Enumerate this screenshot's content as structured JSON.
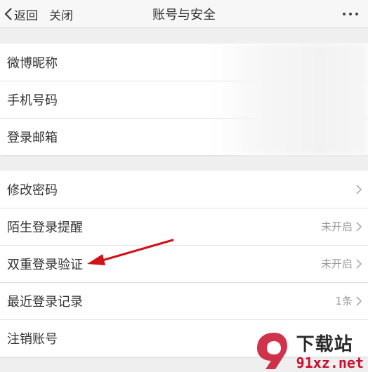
{
  "nav": {
    "back_label": "返回",
    "close_label": "关闭",
    "title": "账号与安全"
  },
  "profile_group": {
    "items": [
      {
        "label": "微博昵称"
      },
      {
        "label": "手机号码"
      },
      {
        "label": "登录邮箱"
      }
    ]
  },
  "security_group": {
    "items": [
      {
        "label": "修改密码",
        "value": ""
      },
      {
        "label": "陌生登录提醒",
        "value": "未开启"
      },
      {
        "label": "双重登录验证",
        "value": "未开启"
      },
      {
        "label": "最近登录记录",
        "value": "1条"
      },
      {
        "label": "注销账号",
        "value": ""
      }
    ]
  },
  "watermark": {
    "name": "下载站",
    "domain": "91xz.net"
  },
  "colors": {
    "background": "#efefef",
    "card": "#ffffff",
    "text": "#333333",
    "secondary_text": "#999999",
    "annotation_arrow": "#d0121b",
    "watermark_red": "#c8102e"
  }
}
